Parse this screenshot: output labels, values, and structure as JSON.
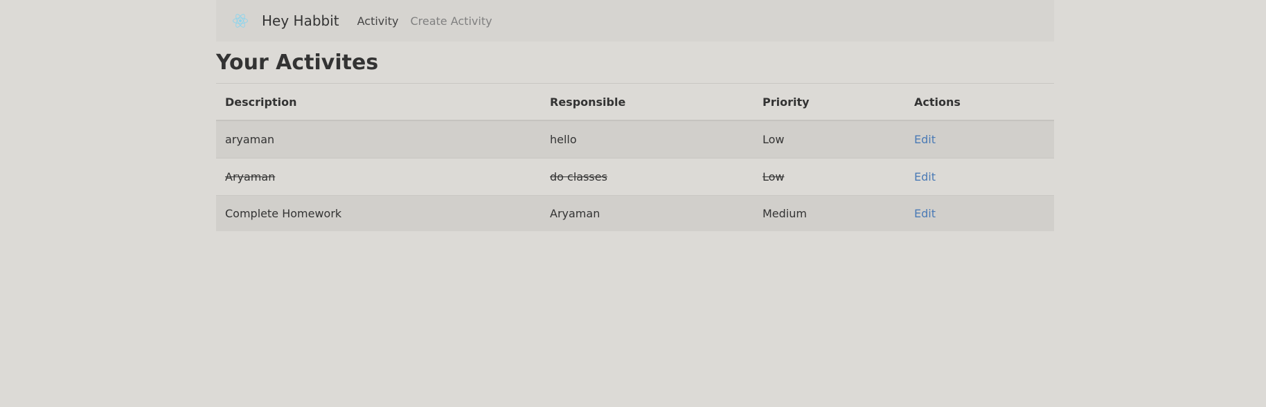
{
  "navbar": {
    "brand_name": "Hey Habbit",
    "logo_icon": "react-logo-icon",
    "links": [
      {
        "label": "Activity",
        "active": true
      },
      {
        "label": "Create Activity",
        "active": false
      }
    ]
  },
  "page": {
    "title": "Your Activites"
  },
  "table": {
    "headers": [
      "Description",
      "Responsible",
      "Priority",
      "Actions"
    ],
    "rows": [
      {
        "description": "aryaman",
        "responsible": "hello",
        "priority": "Low",
        "action": "Edit",
        "completed": false
      },
      {
        "description": "Aryaman",
        "responsible": "do classes",
        "priority": "Low",
        "action": "Edit",
        "completed": true
      },
      {
        "description": "Complete Homework",
        "responsible": "Aryaman",
        "priority": "Medium",
        "action": "Edit",
        "completed": false
      }
    ]
  },
  "colors": {
    "background": "#dcdad6",
    "navbar_bg": "#d6d4d0",
    "link_accent": "#4a7ab5",
    "logo_color": "#61dafb"
  }
}
